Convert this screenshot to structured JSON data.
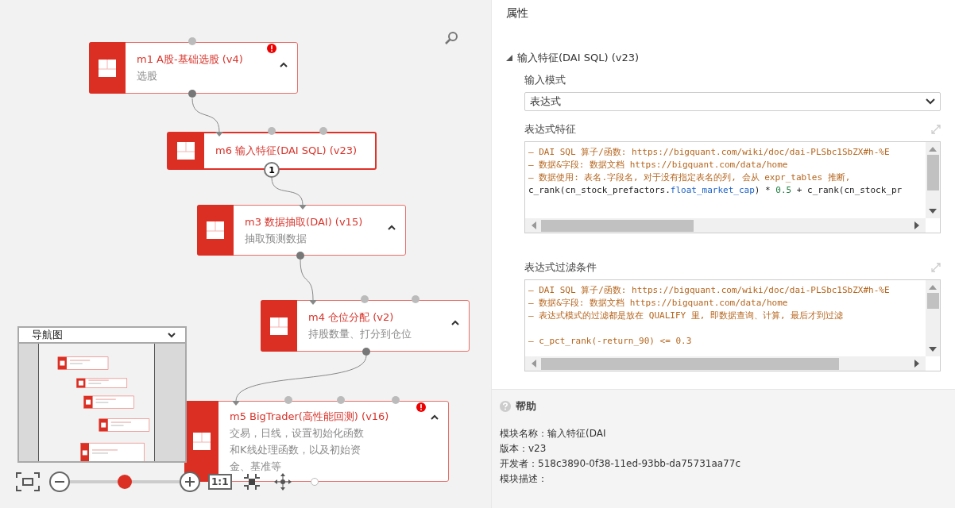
{
  "canvas": {
    "nodes": [
      {
        "title": "m1 A股-基础选股 (v4)",
        "description": [
          "选股"
        ],
        "error": true,
        "selected": false
      },
      {
        "title": "m6 输入特征(DAI SQL) (v23)",
        "error": false,
        "selected": true,
        "output_badge": "1"
      },
      {
        "title": "m3 数据抽取(DAI) (v15)",
        "description": [
          "抽取预测数据"
        ],
        "error": false,
        "selected": false
      },
      {
        "title": "m4 仓位分配 (v2)",
        "description": [
          "持股数量、打分到仓位"
        ],
        "error": false,
        "selected": false
      },
      {
        "title": "m5 BigTrader(高性能回测) (v16)",
        "description": [
          "交易，日线，设置初始化函数",
          "和K线处理函数，以及初始资",
          "金、基准等"
        ],
        "error": true,
        "selected": false
      }
    ],
    "navigator": {
      "title": "导航图"
    },
    "zoom": {
      "level": 0.5,
      "reset_label": "1:1"
    }
  },
  "panel": {
    "title": "属性",
    "section": {
      "title": "输入特征(DAI SQL) (v23)",
      "expanded": true
    },
    "mode": {
      "label": "输入模式",
      "value": "表达式"
    },
    "editors": [
      {
        "label": "表达式特征",
        "lines": [
          [
            {
              "kind": "comment",
              "text": "— DAI SQL 算子/函数: https://bigquant.com/wiki/doc/dai-PLSbc1SbZX#h-%E"
            }
          ],
          [
            {
              "kind": "comment",
              "text": "— 数据&字段: 数据文档 https://bigquant.com/data/home"
            }
          ],
          [
            {
              "kind": "comment",
              "text": "— 数据使用: 表名.字段名, 对于没有指定表名的列, 会从 expr_tables 推断,"
            }
          ],
          [
            {
              "kind": "plain",
              "text": "c_rank(cn_stock_prefactors."
            },
            {
              "kind": "field",
              "text": "float_market_cap"
            },
            {
              "kind": "plain",
              "text": ") * "
            },
            {
              "kind": "number",
              "text": "0.5"
            },
            {
              "kind": "plain",
              "text": " + c_rank(cn_stock_pr"
            }
          ]
        ]
      },
      {
        "label": "表达式过滤条件",
        "lines": [
          [
            {
              "kind": "comment",
              "text": "— DAI SQL 算子/函数: https://bigquant.com/wiki/doc/dai-PLSbc1SbZX#h-%E"
            }
          ],
          [
            {
              "kind": "comment",
              "text": "— 数据&字段: 数据文档 https://bigquant.com/data/home"
            }
          ],
          [
            {
              "kind": "comment",
              "text": "— 表达式模式的过滤都是放在 QUALIFY 里, 即数据查询、计算, 最后才到过滤"
            }
          ],
          [
            {
              "kind": "blank"
            }
          ],
          [
            {
              "kind": "comment",
              "text": "— c_pct_rank(-return_90) <= 0.3"
            }
          ]
        ]
      }
    ]
  },
  "help": {
    "title": "帮助",
    "lines": [
      "模块名称：输入特征(DAI",
      "版本：v23",
      "开发者：518c3890-0f38-11ed-93bb-da75731aa77c",
      "模块描述："
    ]
  }
}
